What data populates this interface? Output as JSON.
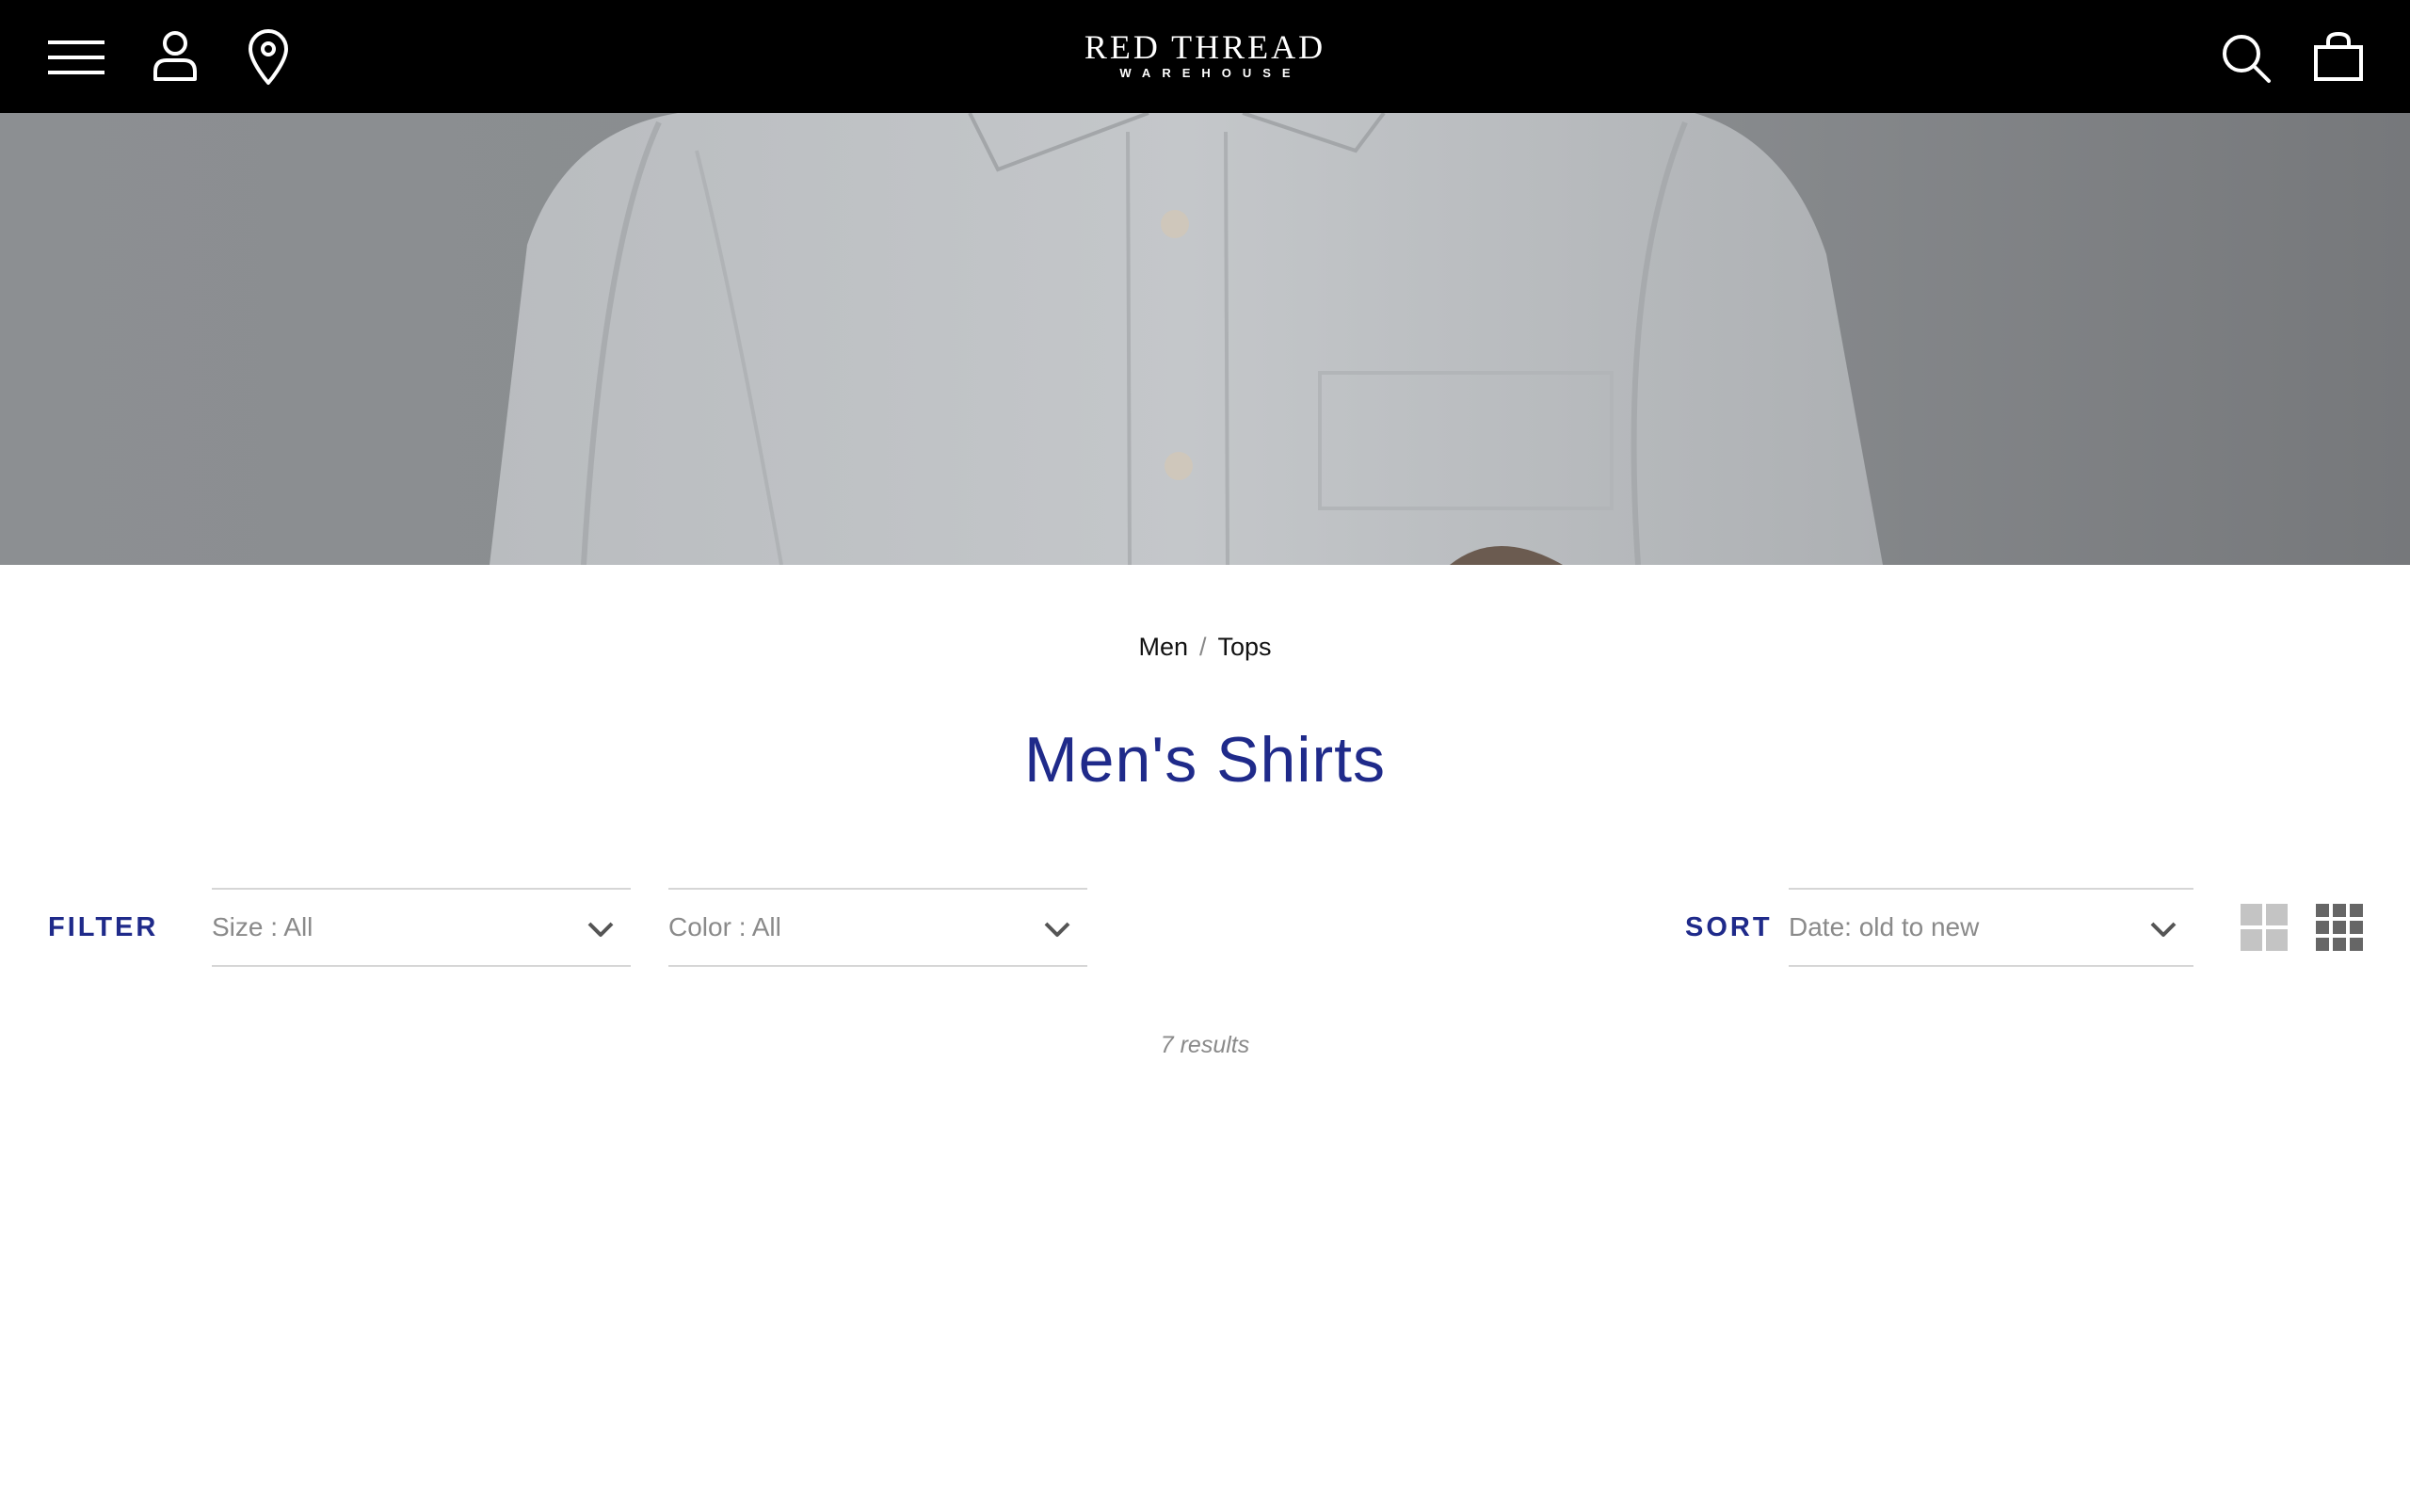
{
  "header": {
    "logo_main": "RED THREAD",
    "logo_sub": "WAREHOUSE",
    "icons": [
      "menu-icon",
      "account-icon",
      "location-pin-icon",
      "search-icon",
      "bag-icon"
    ],
    "background": "#000000"
  },
  "breadcrumb": {
    "items": [
      {
        "label": "Men"
      },
      {
        "label": "Tops"
      }
    ],
    "separator": "/"
  },
  "page": {
    "title": "Men's Shirts",
    "accent_color": "#1f2a8a"
  },
  "filters": {
    "label": "FILTER",
    "size": {
      "value": "Size : All"
    },
    "color": {
      "value": "Color : All"
    }
  },
  "sort": {
    "label": "SORT",
    "value": "Date: old to new"
  },
  "view": {
    "options": [
      "grid-2-icon",
      "grid-3-icon"
    ],
    "selected": "grid-3-icon"
  },
  "results": {
    "text": "7 results"
  }
}
